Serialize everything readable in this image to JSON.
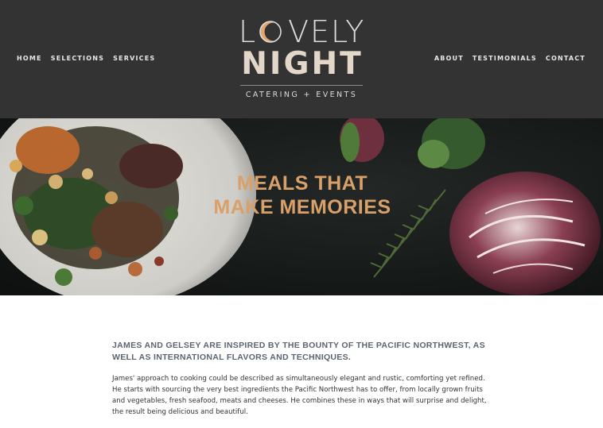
{
  "nav_left": [
    "HOME",
    "SELECTIONS",
    "SERVICES"
  ],
  "nav_right": [
    "ABOUT",
    "TESTIMONIALS",
    "CONTACT"
  ],
  "logo": {
    "word1_first": "L",
    "word1_rest": "VELY",
    "word2": "NIGHT",
    "tagline": "CATERING + EVENTS"
  },
  "hero": {
    "line1": "MEALS THAT",
    "line2": "MAKE MEMORIES"
  },
  "content": {
    "intro": "JAMES AND GELSEY ARE INSPIRED BY THE BOUNTY OF THE PACIFIC NORTHWEST, AS WELL AS INTERNATIONAL FLAVORS AND TECHNIQUES.",
    "body": "James' approach to cooking could be described as simultaneously elegant and rustic, comforting yet refined. He starts with sourcing the very best ingredients the Pacific Northwest has to offer, from locally grown fruits and vegetables, fresh seafood, meats and cheeses. He combines these in ways that will surprise and delight, the result being delicious and beautiful."
  },
  "colors": {
    "header_bg": "#333333",
    "accent_gold": "#d9a06a",
    "intro_text": "#5b6470"
  }
}
